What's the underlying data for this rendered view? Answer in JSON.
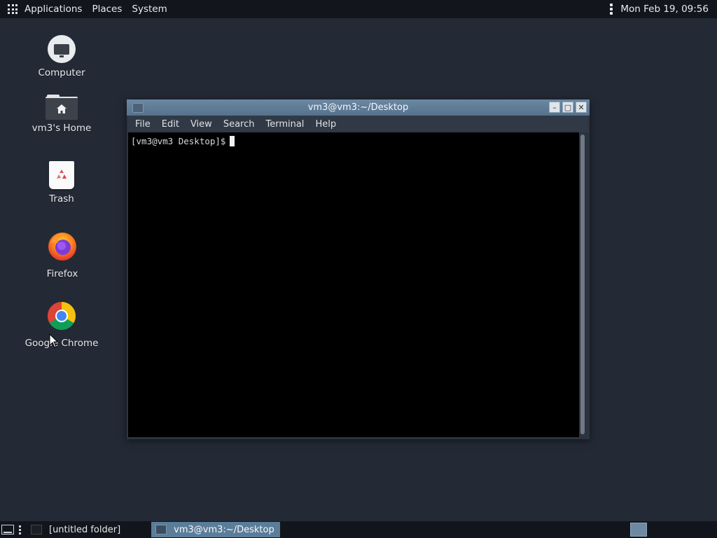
{
  "top_panel": {
    "menus": [
      "Applications",
      "Places",
      "System"
    ],
    "clock": "Mon Feb 19, 09:56"
  },
  "desktop_icons": [
    {
      "label": "Computer",
      "icon": "computer-icon"
    },
    {
      "label": "vm3's Home",
      "icon": "home-folder-icon"
    },
    {
      "label": "Trash",
      "icon": "trash-icon"
    },
    {
      "label": "Firefox",
      "icon": "firefox-icon"
    },
    {
      "label": "Google Chrome",
      "icon": "chrome-icon"
    }
  ],
  "terminal": {
    "title": "vm3@vm3:~/Desktop",
    "menus": [
      "File",
      "Edit",
      "View",
      "Search",
      "Terminal",
      "Help"
    ],
    "prompt": "[vm3@vm3 Desktop]$",
    "minimize": "–",
    "maximize": "□",
    "close": "✕"
  },
  "taskbar": {
    "tasks": [
      {
        "label": "[untitled folder]",
        "active": false
      },
      {
        "label": "vm3@vm3:~/Desktop",
        "active": true
      }
    ]
  },
  "colors": {
    "desktop_bg": "#232a35",
    "panel_bg": "#12161c",
    "titlebar": "#5f7c96",
    "active_task": "#5b7d99"
  }
}
